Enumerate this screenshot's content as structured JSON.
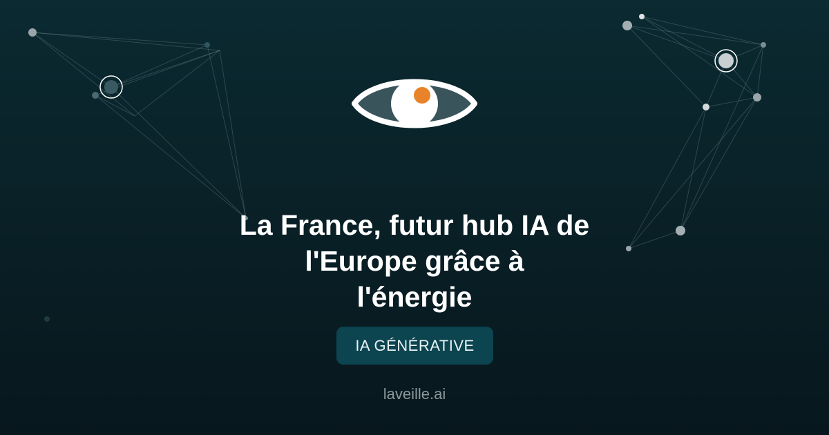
{
  "headline": {
    "lines": [
      "La France, futur hub IA de",
      "l'Europe grâce à",
      "l'énergie"
    ]
  },
  "category": {
    "label": "IA GÉNÉRATIVE"
  },
  "site": {
    "name": "laveille.ai"
  },
  "logo": {
    "icon": "eye-icon",
    "accent_color": "#e8832a"
  },
  "colors": {
    "background_top": "#0b2a31",
    "background_bottom": "#07171d",
    "badge_background": "#0c4450",
    "headline_text": "#ffffff",
    "site_text": "#8c979b"
  }
}
